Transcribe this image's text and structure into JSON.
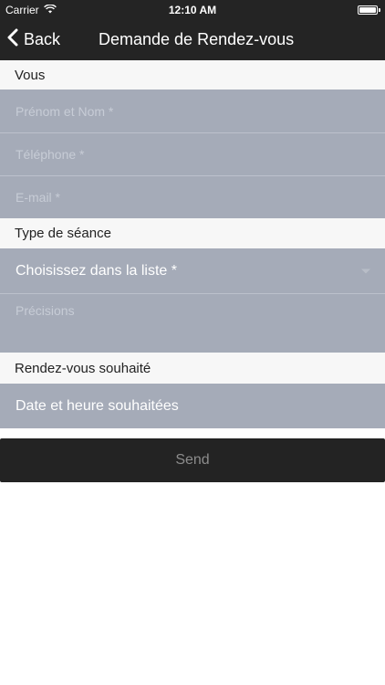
{
  "status_bar": {
    "carrier": "Carrier",
    "time": "12:10 AM",
    "icons": [
      "wifi-icon",
      "battery-icon"
    ]
  },
  "nav": {
    "back_label": "Back",
    "title": "Demande de Rendez-vous"
  },
  "sections": {
    "vous": "Vous",
    "type_seance": "Type de séance",
    "rdv": "Rendez-vous souhaité"
  },
  "fields": {
    "name_placeholder": "Prénom et Nom *",
    "phone_placeholder": "Téléphone *",
    "email_placeholder": "E-mail *",
    "type_select": "Choisissez dans la liste *",
    "precisions_placeholder": "Précisions",
    "datetime": "Date et heure souhaitées"
  },
  "send_label": "Send",
  "colors": {
    "navbar": "#242424",
    "field_bg": "#a5abb8",
    "section_bg": "#f7f7f7",
    "button_bg": "#232323"
  }
}
